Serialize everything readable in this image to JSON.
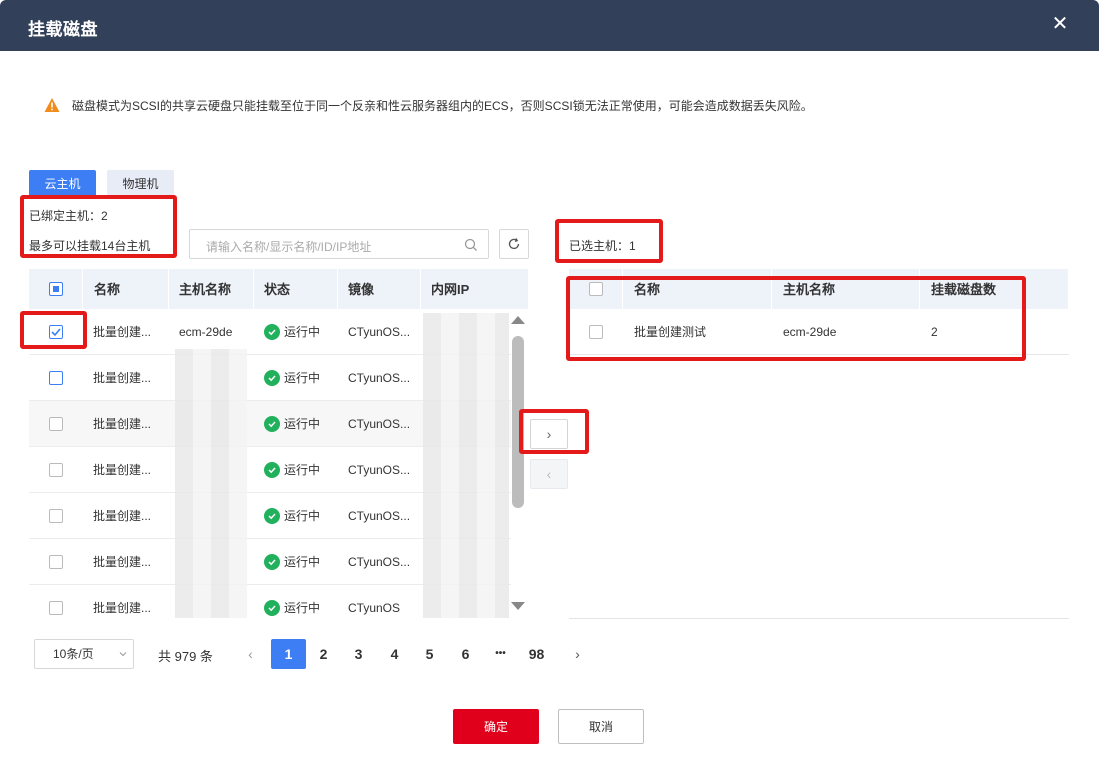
{
  "dialog": {
    "title": "挂载磁盘",
    "close_glyph": "✕"
  },
  "warning": {
    "text": "磁盘模式为SCSI的共享云硬盘只能挂载至位于同一个反亲和性云服务器组内的ECS，否则SCSI锁无法正常使用，可能会造成数据丢失风险。",
    "icon": "warning-triangle-icon",
    "color": "#f08c1b"
  },
  "tabs": [
    {
      "label": "云主机",
      "active": true
    },
    {
      "label": "物理机",
      "active": false
    }
  ],
  "left": {
    "bound_hosts": "已绑定主机：2",
    "max_hosts": "最多可以挂载14台主机",
    "search_placeholder": "请输入名称/显示名称/ID/IP地址",
    "columns": [
      "名称",
      "主机名称",
      "状态",
      "镜像",
      "内网IP"
    ],
    "rows": [
      {
        "name": "批量创建...",
        "host": "ecm-29de",
        "status": "运行中",
        "image": "CTyunOS...",
        "checked": true
      },
      {
        "name": "批量创建...",
        "host": "",
        "status": "运行中",
        "image": "CTyunOS...",
        "checked": false
      },
      {
        "name": "批量创建...",
        "host": "",
        "status": "运行中",
        "image": "CTyunOS...",
        "checked": false
      },
      {
        "name": "批量创建...",
        "host": "",
        "status": "运行中",
        "image": "CTyunOS...",
        "checked": false
      },
      {
        "name": "批量创建...",
        "host": "",
        "status": "运行中",
        "image": "CTyunOS...",
        "checked": false
      },
      {
        "name": "批量创建...",
        "host": "",
        "status": "运行中",
        "image": "CTyunOS...",
        "checked": false
      },
      {
        "name": "批量创建...",
        "host": "",
        "status": "运行中",
        "image": "CTyunOS",
        "checked": false
      }
    ]
  },
  "transfer": {
    "right_glyph": "›",
    "left_glyph": "‹"
  },
  "right": {
    "selected_hosts": "已选主机：1",
    "columns": [
      "名称",
      "主机名称",
      "挂载磁盘数"
    ],
    "rows": [
      {
        "name": "批量创建测试",
        "host": "ecm-29de",
        "disks": "2"
      }
    ]
  },
  "pagination": {
    "page_size": "10条/页",
    "total": "共 979 条",
    "pages": [
      "1",
      "2",
      "3",
      "4",
      "5",
      "6",
      "•••",
      "98"
    ],
    "current": "1"
  },
  "footer": {
    "ok": "确定",
    "cancel": "取消"
  },
  "colors": {
    "header_bg": "#334059",
    "primary": "#3d7ef5",
    "confirm": "#e0001b",
    "highlight_box": "#e41a1a",
    "running": "#21b15c"
  }
}
